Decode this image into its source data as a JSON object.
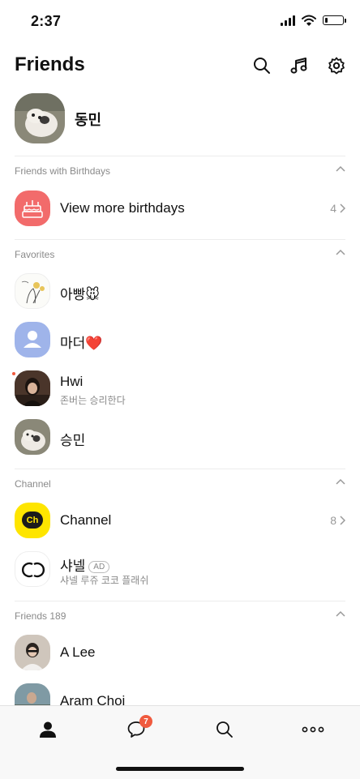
{
  "status": {
    "time": "2:37"
  },
  "header": {
    "title": "Friends"
  },
  "profile": {
    "name": "동민"
  },
  "birthdays": {
    "section_label": "Friends with Birthdays",
    "row_title": "View more birthdays",
    "count": "4"
  },
  "favorites": {
    "section_label": "Favorites",
    "items": [
      {
        "name": "아빵🐭",
        "status": ""
      },
      {
        "name": "마더❤️",
        "status": ""
      },
      {
        "name": "Hwi",
        "status": "존버는 승리한다"
      },
      {
        "name": "승민",
        "status": ""
      }
    ]
  },
  "channel": {
    "section_label": "Channel",
    "row_title": "Channel",
    "count": "8",
    "logo_text": "Ch",
    "items": [
      {
        "name": "샤넬",
        "badge": "AD",
        "status": "샤넬 루쥬 코코 플래쉬"
      }
    ]
  },
  "friends": {
    "section_label": "Friends 189",
    "items": [
      {
        "name": "A Lee"
      },
      {
        "name": "Aram Choi"
      }
    ]
  },
  "tabbar": {
    "chat_badge": "7"
  },
  "colors": {
    "birthday_icon_bg": "#f26b6b",
    "channel_yellow": "#fee500",
    "badge_red": "#f05a3e",
    "default_avatar_bg": "#9fb4ea"
  }
}
